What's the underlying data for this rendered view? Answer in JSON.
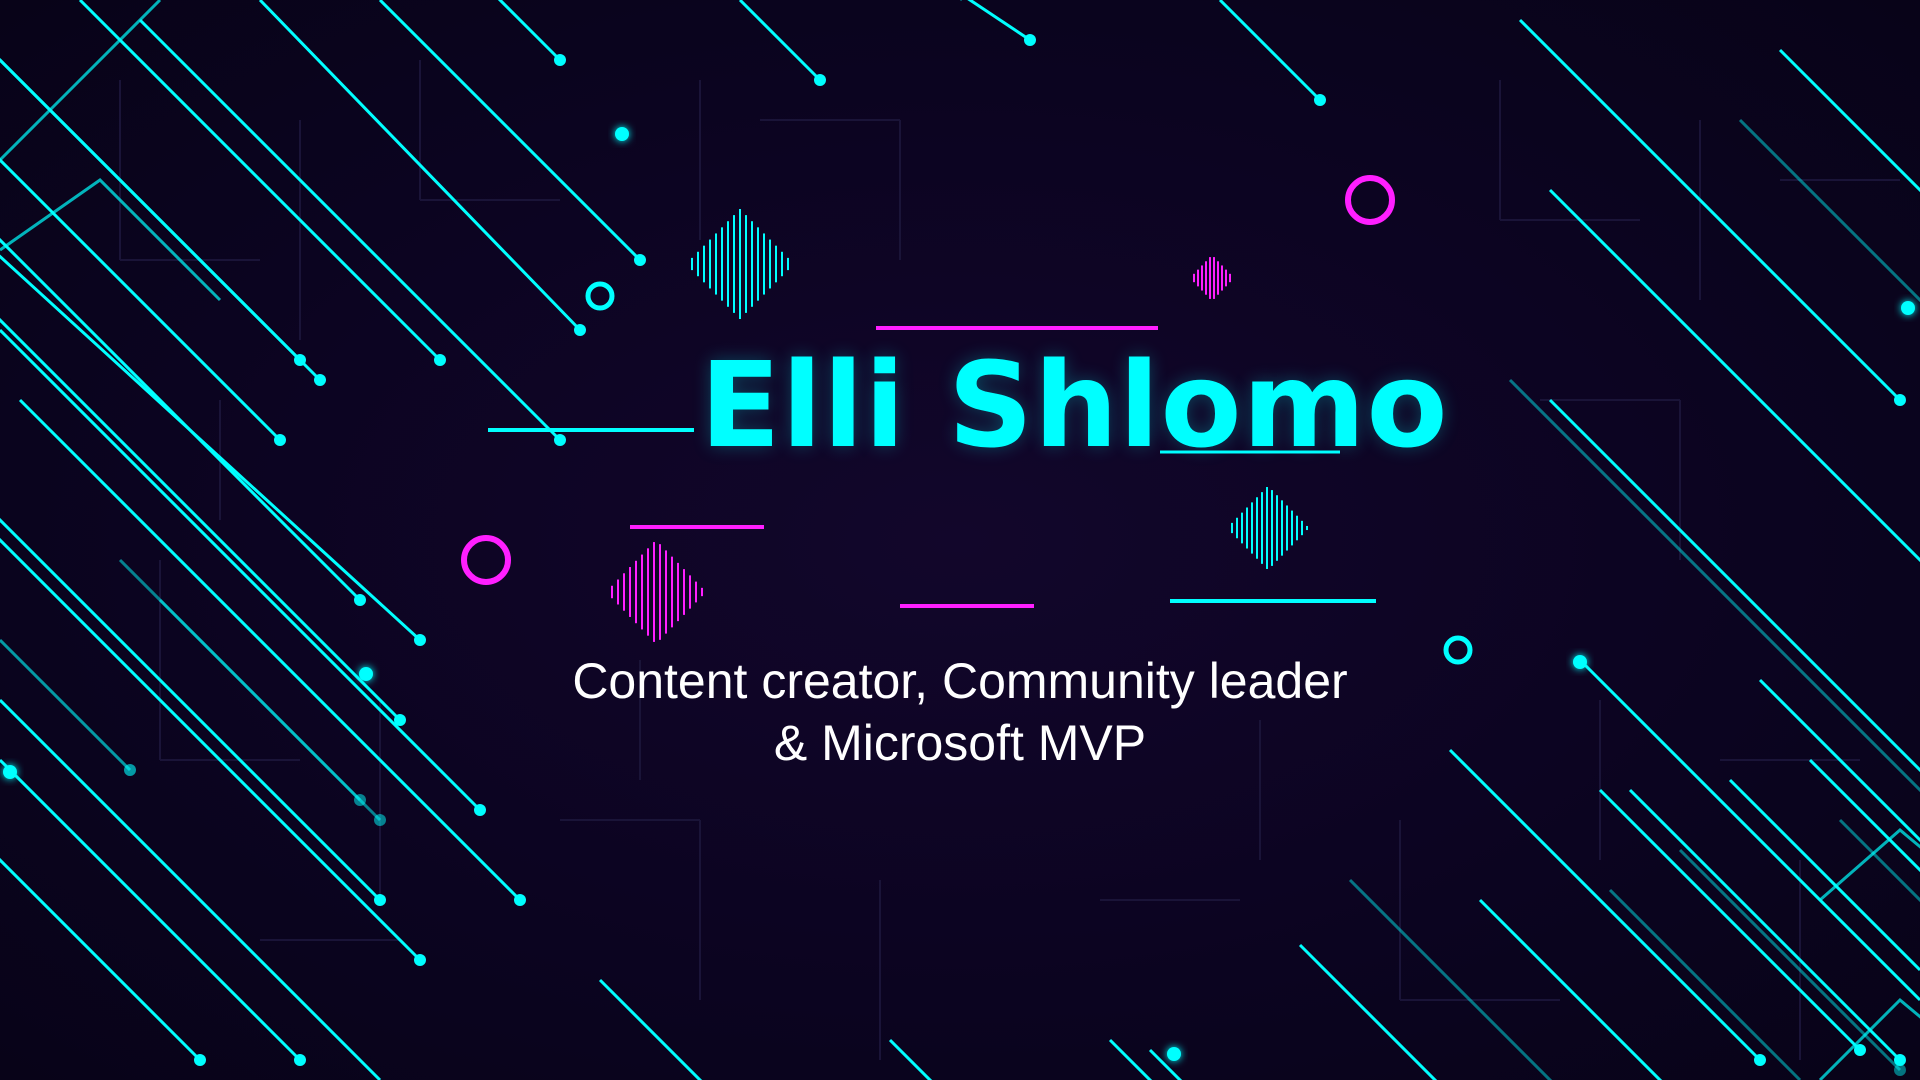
{
  "name": "Elli Shlomo",
  "tagline": {
    "line1": "Content creator, Community leader",
    "line2": "& Microsoft MVP"
  },
  "colors": {
    "background": "#0b0420",
    "accent_cyan": "#00ffff",
    "accent_magenta": "#ff1fff",
    "text_white": "#ffffff",
    "circuit_dim": "#1a1438"
  }
}
